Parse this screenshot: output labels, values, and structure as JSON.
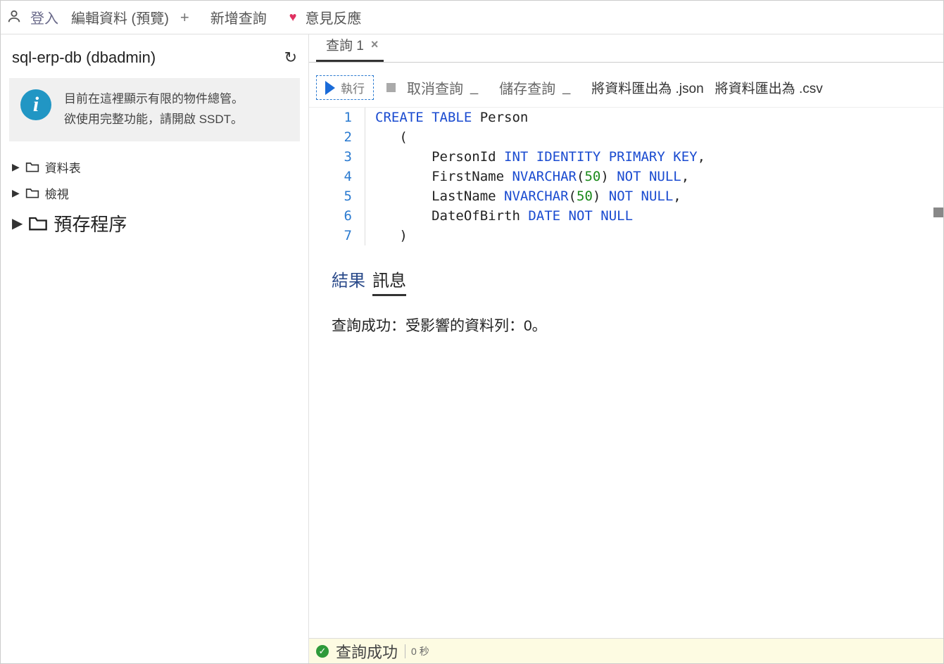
{
  "topbar": {
    "login": "登入",
    "edit_data": "編輯資料 (預覽)",
    "new_query": "新增查詢",
    "feedback": "意見反應"
  },
  "sidebar": {
    "db_name": "sql-erp-db (dbadmin)",
    "info_line1": "目前在這裡顯示有限的物件總管。",
    "info_line2": "欲使用完整功能，請開啟 SSDT。",
    "tree": {
      "tables": "資料表",
      "views": "檢視",
      "stored_procs": "預存程序"
    }
  },
  "tabs": {
    "query1": "查詢 1"
  },
  "query_toolbar": {
    "run": "執行",
    "cancel": "取消查詢",
    "save": "儲存查詢",
    "export_json": "將資料匯出為 .json",
    "export_csv": "將資料匯出為 .csv"
  },
  "editor": {
    "lines": [
      {
        "n": "1",
        "tokens": [
          {
            "t": "CREATE TABLE",
            "c": "kw"
          },
          {
            "t": " Person",
            "c": "ident"
          }
        ]
      },
      {
        "n": "2",
        "tokens": [
          {
            "t": "   (",
            "c": "ident"
          }
        ]
      },
      {
        "n": "3",
        "tokens": [
          {
            "t": "       PersonId ",
            "c": "ident"
          },
          {
            "t": "INT IDENTITY PRIMARY KEY",
            "c": "kw"
          },
          {
            "t": ",",
            "c": "ident"
          }
        ]
      },
      {
        "n": "4",
        "tokens": [
          {
            "t": "       FirstName ",
            "c": "ident"
          },
          {
            "t": "NVARCHAR",
            "c": "kw"
          },
          {
            "t": "(",
            "c": "ident"
          },
          {
            "t": "50",
            "c": "num"
          },
          {
            "t": ") ",
            "c": "ident"
          },
          {
            "t": "NOT NULL",
            "c": "kw"
          },
          {
            "t": ",",
            "c": "ident"
          }
        ]
      },
      {
        "n": "5",
        "tokens": [
          {
            "t": "       LastName ",
            "c": "ident"
          },
          {
            "t": "NVARCHAR",
            "c": "kw"
          },
          {
            "t": "(",
            "c": "ident"
          },
          {
            "t": "50",
            "c": "num"
          },
          {
            "t": ") ",
            "c": "ident"
          },
          {
            "t": "NOT NULL",
            "c": "kw"
          },
          {
            "t": ",",
            "c": "ident"
          }
        ]
      },
      {
        "n": "6",
        "tokens": [
          {
            "t": "       DateOfBirth ",
            "c": "ident"
          },
          {
            "t": "DATE NOT NULL",
            "c": "kw"
          }
        ]
      },
      {
        "n": "7",
        "tokens": [
          {
            "t": "   )",
            "c": "ident"
          }
        ]
      }
    ]
  },
  "results": {
    "tab_results": "結果",
    "tab_messages": "訊息",
    "message": "查詢成功：受影響的資料列：0。"
  },
  "status": {
    "text": "查詢成功",
    "time": "0 秒"
  }
}
